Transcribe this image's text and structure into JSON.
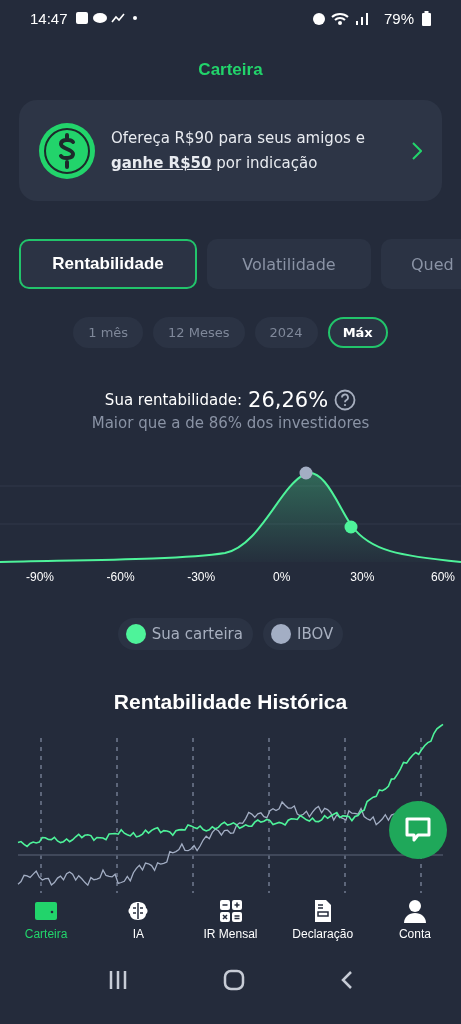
{
  "status_bar": {
    "time": "14:47",
    "battery": "79%"
  },
  "header": {
    "title": "Carteira"
  },
  "promo": {
    "text": "Ofereça R$90 para seus amigos e **ganhe R$50** por indicação"
  },
  "tabs": [
    {
      "label": "Rentabilidade",
      "selected": true
    },
    {
      "label": "Volatilidade",
      "selected": false
    },
    {
      "label": "Qued",
      "selected": false
    }
  ],
  "periods": [
    {
      "label": "1 mês",
      "selected": false
    },
    {
      "label": "12 Meses",
      "selected": false
    },
    {
      "label": "2024",
      "selected": false
    },
    {
      "label": "Máx",
      "selected": true
    }
  ],
  "summary": {
    "label": "Sua rentabilidade:",
    "value": "26,26%",
    "subtitle": "Maior que a de 86% dos investidores"
  },
  "distribution": {
    "x_labels": [
      "-90%",
      "-60%",
      "-30%",
      "0%",
      "30%",
      "60%"
    ]
  },
  "legend": [
    {
      "label": "Sua carteira",
      "color": "#4ef39a"
    },
    {
      "label": "IBOV",
      "color": "#a3aec4"
    }
  ],
  "history": {
    "title": "Rentabilidade Histórica"
  },
  "nav": [
    {
      "label": "Carteira",
      "selected": true
    },
    {
      "label": "IA",
      "selected": false
    },
    {
      "label": "IR Mensal",
      "selected": false
    },
    {
      "label": "Declaração",
      "selected": false
    },
    {
      "label": "Conta",
      "selected": false
    }
  ]
}
